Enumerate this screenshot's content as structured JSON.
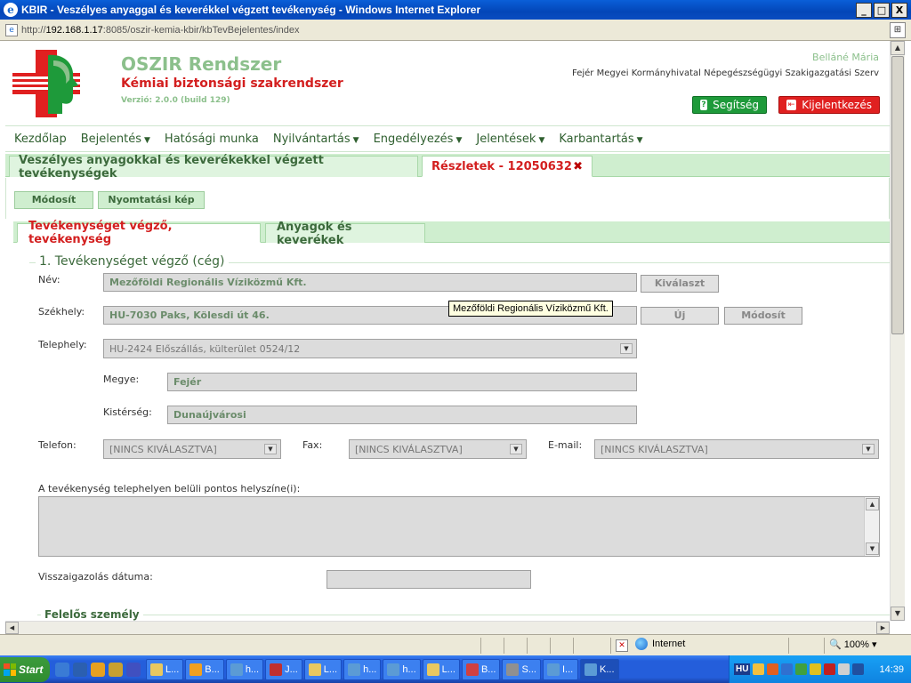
{
  "window": {
    "title": "KBIR - Veszélyes anyaggal és keverékkel végzett tevékenység - Windows Internet Explorer",
    "btn_min": "_",
    "btn_max": "□",
    "btn_close": "X"
  },
  "address": {
    "prefix": "http://",
    "host": "192.168.1.17",
    "rest": ":8085/oszir-kemia-kbir/kbTevBejelentes/index"
  },
  "header": {
    "app_title": "OSZIR Rendszer",
    "app_subtitle": "Kémiai biztonsági szakrendszer",
    "version": "Verzió: 2.0.0 (build 129)",
    "user_name": "Belláné Mária",
    "organization": "Fejér Megyei Kormányhivatal Népegészségügyi Szakigazgatási Szerv",
    "help_label": "Segítség",
    "logout_label": "Kijelentkezés"
  },
  "menu": {
    "items": [
      {
        "label": "Kezdőlap",
        "caret": ""
      },
      {
        "label": "Bejelentés",
        "caret": "▼"
      },
      {
        "label": "Hatósági munka",
        "caret": ""
      },
      {
        "label": "Nyilvántartás",
        "caret": "▼"
      },
      {
        "label": "Engedélyezés",
        "caret": "▼"
      },
      {
        "label": "Jelentések",
        "caret": "▼"
      },
      {
        "label": "Karbantartás",
        "caret": "▼"
      }
    ]
  },
  "page_tabs": {
    "list_tab": "Veszélyes anyagokkal és keverékekkel végzett tevékenységek",
    "detail_tab": "Részletek - 12050632",
    "close_glyph": "✖"
  },
  "actions": {
    "modify": "Módosít",
    "print_view": "Nyomtatási kép"
  },
  "inner_tabs": {
    "tab1": "Tevékenységet végző, tevékenység",
    "tab2": "Anyagok és keverékek"
  },
  "form": {
    "section_title": "1. Tevékenységet végző (cég)",
    "name_label": "Név:",
    "name_value": "Mezőföldi Regionális Víziközmű Kft.",
    "select_button": "Kiválaszt",
    "seat_label": "Székhely:",
    "seat_value": "HU-7030 Paks, Kölesdi út 46.",
    "new_button": "Új",
    "modify_button": "Módosít",
    "site_label": "Telephely:",
    "site_value": "HU-2424 Előszállás, külterület 0524/12",
    "county_label": "Megye:",
    "county_value": "Fejér",
    "region_label": "Kistérség:",
    "region_value": "Dunaújvárosi",
    "phone_label": "Telefon:",
    "phone_value": "[NINCS KIVÁLASZTVA]",
    "fax_label": "Fax:",
    "fax_value": "[NINCS KIVÁLASZTVA]",
    "email_label": "E-mail:",
    "email_value": "[NINCS KIVÁLASZTVA]",
    "location_label": "A tevékenység telephelyen belüli pontos helyszíne(i):",
    "confirm_date_label": "Visszaigazolás dátuma:",
    "responsible_title": "Felelős személy",
    "tooltip": "Mezőföldi Regionális Víziközmű Kft."
  },
  "statusbar": {
    "zone": "Internet",
    "zoom": "100%"
  },
  "taskbar": {
    "start": "Start",
    "tasks": [
      "L...",
      "B...",
      "h...",
      "J...",
      "L...",
      "h...",
      "h...",
      "L...",
      "B...",
      "S...",
      "I...",
      "K..."
    ],
    "tray_lang": "HU",
    "clock": "14:39"
  }
}
